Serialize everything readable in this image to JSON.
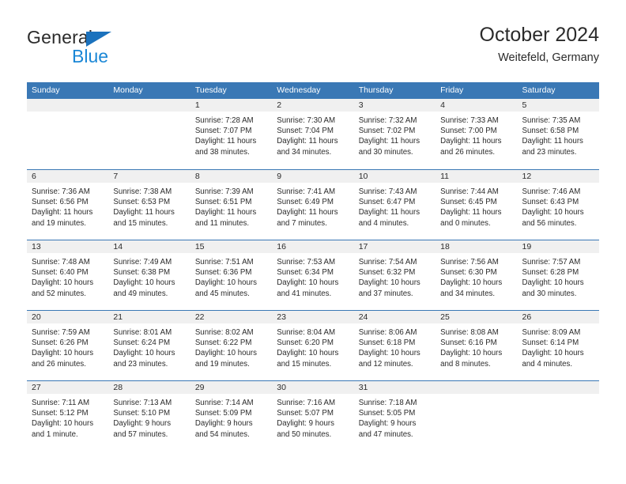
{
  "brand": {
    "name_top": "General",
    "name_bottom": "Blue",
    "triangle_color": "#1b72bd",
    "blue_color": "#1b87d6"
  },
  "header": {
    "title": "October 2024",
    "subtitle": "Weitefeld, Germany"
  },
  "theme": {
    "header_blue": "#3a78b5",
    "band_gray": "#f0f0f0",
    "text": "#2b2b2b"
  },
  "weekdays": [
    "Sunday",
    "Monday",
    "Tuesday",
    "Wednesday",
    "Thursday",
    "Friday",
    "Saturday"
  ],
  "weeks": [
    [
      {
        "day": "",
        "lines": []
      },
      {
        "day": "",
        "lines": []
      },
      {
        "day": "1",
        "lines": [
          "Sunrise: 7:28 AM",
          "Sunset: 7:07 PM",
          "Daylight: 11 hours",
          "and 38 minutes."
        ]
      },
      {
        "day": "2",
        "lines": [
          "Sunrise: 7:30 AM",
          "Sunset: 7:04 PM",
          "Daylight: 11 hours",
          "and 34 minutes."
        ]
      },
      {
        "day": "3",
        "lines": [
          "Sunrise: 7:32 AM",
          "Sunset: 7:02 PM",
          "Daylight: 11 hours",
          "and 30 minutes."
        ]
      },
      {
        "day": "4",
        "lines": [
          "Sunrise: 7:33 AM",
          "Sunset: 7:00 PM",
          "Daylight: 11 hours",
          "and 26 minutes."
        ]
      },
      {
        "day": "5",
        "lines": [
          "Sunrise: 7:35 AM",
          "Sunset: 6:58 PM",
          "Daylight: 11 hours",
          "and 23 minutes."
        ]
      }
    ],
    [
      {
        "day": "6",
        "lines": [
          "Sunrise: 7:36 AM",
          "Sunset: 6:56 PM",
          "Daylight: 11 hours",
          "and 19 minutes."
        ]
      },
      {
        "day": "7",
        "lines": [
          "Sunrise: 7:38 AM",
          "Sunset: 6:53 PM",
          "Daylight: 11 hours",
          "and 15 minutes."
        ]
      },
      {
        "day": "8",
        "lines": [
          "Sunrise: 7:39 AM",
          "Sunset: 6:51 PM",
          "Daylight: 11 hours",
          "and 11 minutes."
        ]
      },
      {
        "day": "9",
        "lines": [
          "Sunrise: 7:41 AM",
          "Sunset: 6:49 PM",
          "Daylight: 11 hours",
          "and 7 minutes."
        ]
      },
      {
        "day": "10",
        "lines": [
          "Sunrise: 7:43 AM",
          "Sunset: 6:47 PM",
          "Daylight: 11 hours",
          "and 4 minutes."
        ]
      },
      {
        "day": "11",
        "lines": [
          "Sunrise: 7:44 AM",
          "Sunset: 6:45 PM",
          "Daylight: 11 hours",
          "and 0 minutes."
        ]
      },
      {
        "day": "12",
        "lines": [
          "Sunrise: 7:46 AM",
          "Sunset: 6:43 PM",
          "Daylight: 10 hours",
          "and 56 minutes."
        ]
      }
    ],
    [
      {
        "day": "13",
        "lines": [
          "Sunrise: 7:48 AM",
          "Sunset: 6:40 PM",
          "Daylight: 10 hours",
          "and 52 minutes."
        ]
      },
      {
        "day": "14",
        "lines": [
          "Sunrise: 7:49 AM",
          "Sunset: 6:38 PM",
          "Daylight: 10 hours",
          "and 49 minutes."
        ]
      },
      {
        "day": "15",
        "lines": [
          "Sunrise: 7:51 AM",
          "Sunset: 6:36 PM",
          "Daylight: 10 hours",
          "and 45 minutes."
        ]
      },
      {
        "day": "16",
        "lines": [
          "Sunrise: 7:53 AM",
          "Sunset: 6:34 PM",
          "Daylight: 10 hours",
          "and 41 minutes."
        ]
      },
      {
        "day": "17",
        "lines": [
          "Sunrise: 7:54 AM",
          "Sunset: 6:32 PM",
          "Daylight: 10 hours",
          "and 37 minutes."
        ]
      },
      {
        "day": "18",
        "lines": [
          "Sunrise: 7:56 AM",
          "Sunset: 6:30 PM",
          "Daylight: 10 hours",
          "and 34 minutes."
        ]
      },
      {
        "day": "19",
        "lines": [
          "Sunrise: 7:57 AM",
          "Sunset: 6:28 PM",
          "Daylight: 10 hours",
          "and 30 minutes."
        ]
      }
    ],
    [
      {
        "day": "20",
        "lines": [
          "Sunrise: 7:59 AM",
          "Sunset: 6:26 PM",
          "Daylight: 10 hours",
          "and 26 minutes."
        ]
      },
      {
        "day": "21",
        "lines": [
          "Sunrise: 8:01 AM",
          "Sunset: 6:24 PM",
          "Daylight: 10 hours",
          "and 23 minutes."
        ]
      },
      {
        "day": "22",
        "lines": [
          "Sunrise: 8:02 AM",
          "Sunset: 6:22 PM",
          "Daylight: 10 hours",
          "and 19 minutes."
        ]
      },
      {
        "day": "23",
        "lines": [
          "Sunrise: 8:04 AM",
          "Sunset: 6:20 PM",
          "Daylight: 10 hours",
          "and 15 minutes."
        ]
      },
      {
        "day": "24",
        "lines": [
          "Sunrise: 8:06 AM",
          "Sunset: 6:18 PM",
          "Daylight: 10 hours",
          "and 12 minutes."
        ]
      },
      {
        "day": "25",
        "lines": [
          "Sunrise: 8:08 AM",
          "Sunset: 6:16 PM",
          "Daylight: 10 hours",
          "and 8 minutes."
        ]
      },
      {
        "day": "26",
        "lines": [
          "Sunrise: 8:09 AM",
          "Sunset: 6:14 PM",
          "Daylight: 10 hours",
          "and 4 minutes."
        ]
      }
    ],
    [
      {
        "day": "27",
        "lines": [
          "Sunrise: 7:11 AM",
          "Sunset: 5:12 PM",
          "Daylight: 10 hours",
          "and 1 minute."
        ]
      },
      {
        "day": "28",
        "lines": [
          "Sunrise: 7:13 AM",
          "Sunset: 5:10 PM",
          "Daylight: 9 hours",
          "and 57 minutes."
        ]
      },
      {
        "day": "29",
        "lines": [
          "Sunrise: 7:14 AM",
          "Sunset: 5:09 PM",
          "Daylight: 9 hours",
          "and 54 minutes."
        ]
      },
      {
        "day": "30",
        "lines": [
          "Sunrise: 7:16 AM",
          "Sunset: 5:07 PM",
          "Daylight: 9 hours",
          "and 50 minutes."
        ]
      },
      {
        "day": "31",
        "lines": [
          "Sunrise: 7:18 AM",
          "Sunset: 5:05 PM",
          "Daylight: 9 hours",
          "and 47 minutes."
        ]
      },
      {
        "day": "",
        "lines": []
      },
      {
        "day": "",
        "lines": []
      }
    ]
  ]
}
